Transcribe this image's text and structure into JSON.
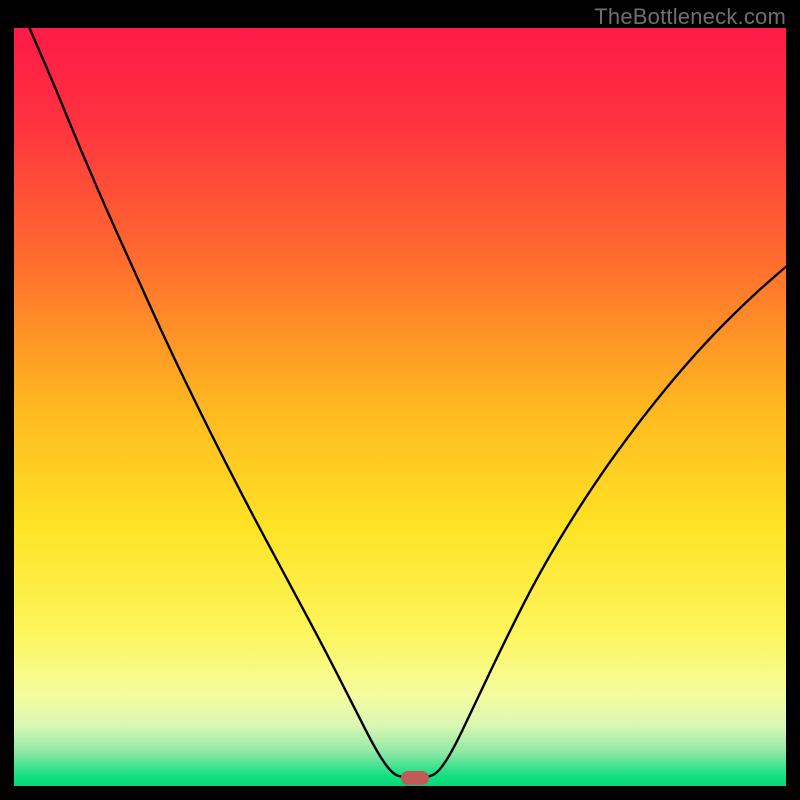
{
  "watermark": "TheBottleneck.com",
  "chart_data": {
    "type": "line",
    "title": "",
    "xlabel": "",
    "ylabel": "",
    "xlim": [
      0,
      100
    ],
    "ylim": [
      0,
      100
    ],
    "background_gradient_stops": [
      {
        "offset": 0.0,
        "color": "#ff1a48"
      },
      {
        "offset": 0.12,
        "color": "#ff3140"
      },
      {
        "offset": 0.3,
        "color": "#ff6a2f"
      },
      {
        "offset": 0.5,
        "color": "#ffb820"
      },
      {
        "offset": 0.66,
        "color": "#ffe325"
      },
      {
        "offset": 0.8,
        "color": "#fcf65e"
      },
      {
        "offset": 0.88,
        "color": "#f6fca0"
      },
      {
        "offset": 0.92,
        "color": "#d9f8b2"
      },
      {
        "offset": 0.955,
        "color": "#8fe8a7"
      },
      {
        "offset": 0.985,
        "color": "#18e082"
      },
      {
        "offset": 1.0,
        "color": "#06d873"
      }
    ],
    "series": [
      {
        "name": "bottleneck-curve",
        "stroke": "#000000",
        "stroke_width": 2.4,
        "points": [
          {
            "x": 2.0,
            "y": 100.0
          },
          {
            "x": 5.0,
            "y": 93.0
          },
          {
            "x": 8.0,
            "y": 85.5
          },
          {
            "x": 12.0,
            "y": 76.0
          },
          {
            "x": 16.0,
            "y": 67.0
          },
          {
            "x": 20.0,
            "y": 58.0
          },
          {
            "x": 25.0,
            "y": 47.5
          },
          {
            "x": 30.0,
            "y": 37.5
          },
          {
            "x": 35.0,
            "y": 28.0
          },
          {
            "x": 40.0,
            "y": 18.5
          },
          {
            "x": 44.0,
            "y": 10.5
          },
          {
            "x": 47.0,
            "y": 4.5
          },
          {
            "x": 49.0,
            "y": 1.6
          },
          {
            "x": 50.5,
            "y": 1.1
          },
          {
            "x": 53.5,
            "y": 1.1
          },
          {
            "x": 55.0,
            "y": 1.8
          },
          {
            "x": 57.0,
            "y": 5.0
          },
          {
            "x": 60.0,
            "y": 11.5
          },
          {
            "x": 64.0,
            "y": 20.0
          },
          {
            "x": 68.0,
            "y": 28.0
          },
          {
            "x": 73.0,
            "y": 36.5
          },
          {
            "x": 78.0,
            "y": 44.0
          },
          {
            "x": 84.0,
            "y": 52.0
          },
          {
            "x": 90.0,
            "y": 59.0
          },
          {
            "x": 96.0,
            "y": 65.0
          },
          {
            "x": 100.0,
            "y": 68.5
          }
        ]
      }
    ],
    "marker": {
      "x": 52.0,
      "y": 1.1,
      "color": "#c15a5a"
    }
  }
}
